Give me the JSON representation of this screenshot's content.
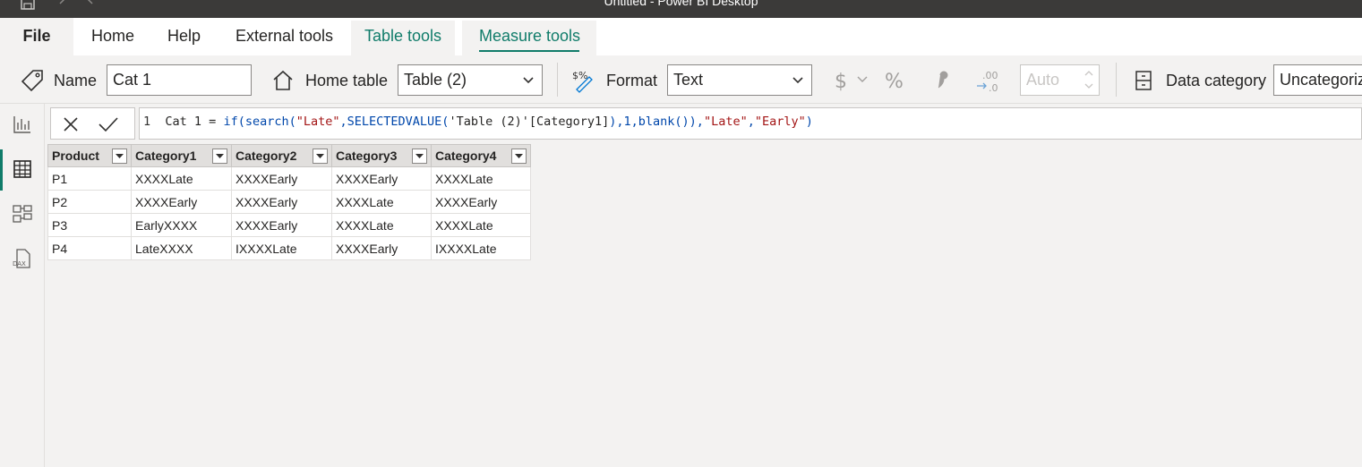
{
  "app": {
    "window_title": "Untitled - Power BI Desktop"
  },
  "tabs": [
    {
      "label": "File"
    },
    {
      "label": "Home"
    },
    {
      "label": "Help"
    },
    {
      "label": "External tools"
    },
    {
      "label": "Table tools"
    },
    {
      "label": "Measure tools"
    }
  ],
  "ribbon": {
    "name_label": "Name",
    "name_value": "Cat 1",
    "home_table_label": "Home table",
    "home_table_value": "Table (2)",
    "format_label": "Format",
    "format_value": "Text",
    "decimal_value": "Auto",
    "data_category_label": "Data category",
    "data_category_value": "Uncategorized"
  },
  "formula": {
    "line_number": "1",
    "tokens": [
      {
        "text": "Cat 1 = ",
        "kind": "txt"
      },
      {
        "text": "if(search(",
        "kind": "fn"
      },
      {
        "text": "\"Late\"",
        "kind": "str"
      },
      {
        "text": ",",
        "kind": "fn"
      },
      {
        "text": "SELECTEDVALUE(",
        "kind": "fn"
      },
      {
        "text": "'Table (2)'[Category1]",
        "kind": "col"
      },
      {
        "text": "),1,",
        "kind": "fn"
      },
      {
        "text": "blank()",
        "kind": "fn"
      },
      {
        "text": "),",
        "kind": "fn"
      },
      {
        "text": "\"Late\"",
        "kind": "str"
      },
      {
        "text": ",",
        "kind": "fn"
      },
      {
        "text": "\"Early\"",
        "kind": "str"
      },
      {
        "text": ")",
        "kind": "fn"
      }
    ]
  },
  "table": {
    "columns": [
      "Product",
      "Category1",
      "Category2",
      "Category3",
      "Category4"
    ],
    "rows": [
      [
        "P1",
        "XXXXLate",
        "XXXXEarly",
        "XXXXEarly",
        "XXXXLate"
      ],
      [
        "P2",
        "XXXXEarly",
        "XXXXEarly",
        "XXXXLate",
        "XXXXEarly"
      ],
      [
        "P3",
        "EarlyXXXX",
        "XXXXEarly",
        "XXXXLate",
        "XXXXLate"
      ],
      [
        "P4",
        "LateXXXX",
        "IXXXXLate",
        "XXXXEarly",
        "IXXXXLate"
      ]
    ]
  },
  "colors": {
    "accent": "#107c6a",
    "ribbon_bg": "#f3f2f1",
    "titlebar_bg": "#3b3a39"
  },
  "icons": {
    "titlebar": [
      "save-icon",
      "undo-icon",
      "redo-icon"
    ],
    "sidebar": [
      "report-view-icon",
      "table-view-icon",
      "model-view-icon",
      "dax-query-icon"
    ],
    "ribbon": [
      "tag-icon",
      "home-icon",
      "format-icon",
      "currency-icon",
      "percent-icon",
      "comma-icon",
      "decimal-icon",
      "data-category-icon"
    ]
  }
}
